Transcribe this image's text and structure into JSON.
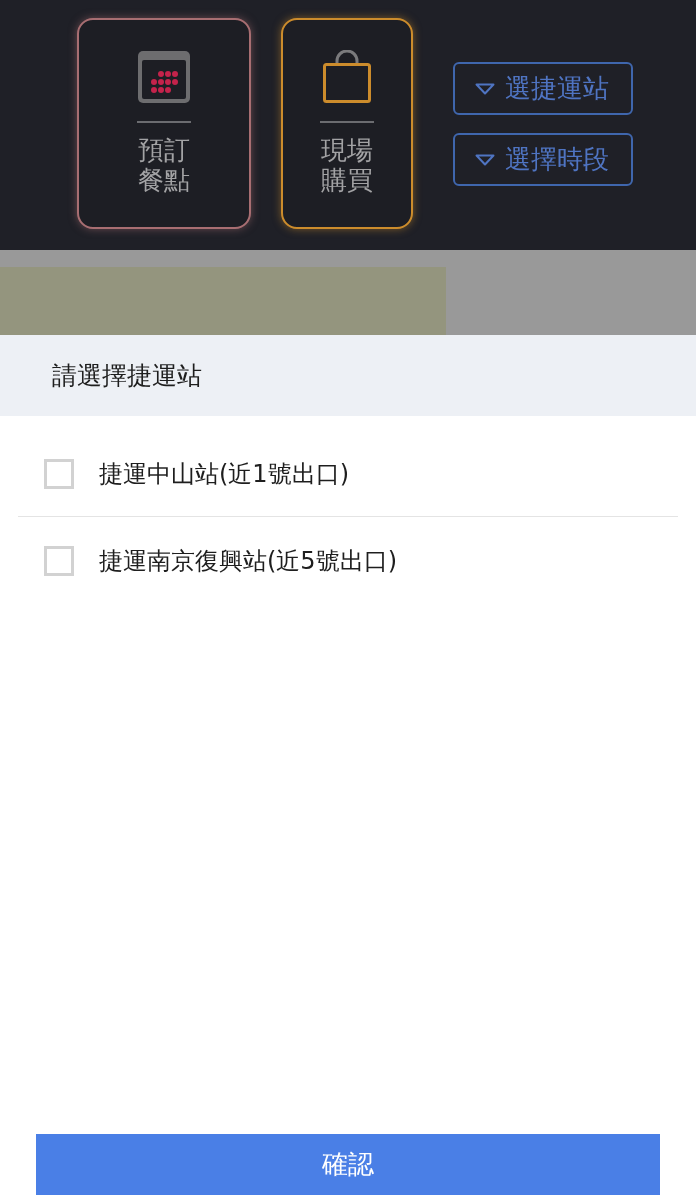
{
  "order_modes": [
    {
      "kind": "preorder",
      "lines": [
        "預訂",
        "餐點"
      ],
      "color": "#a86e72"
    },
    {
      "kind": "onsite",
      "lines": [
        "現場",
        "購買"
      ],
      "color": "#cc8c2c"
    }
  ],
  "filters": [
    {
      "label": "選捷運站"
    },
    {
      "label": "選擇時段"
    }
  ],
  "sheet": {
    "title": "請選擇捷運站",
    "options": [
      {
        "label": "捷運中山站(近1號出口)",
        "checked": false
      },
      {
        "label": "捷運南京復興站(近5號出口)",
        "checked": false
      }
    ],
    "confirm": "確認"
  }
}
